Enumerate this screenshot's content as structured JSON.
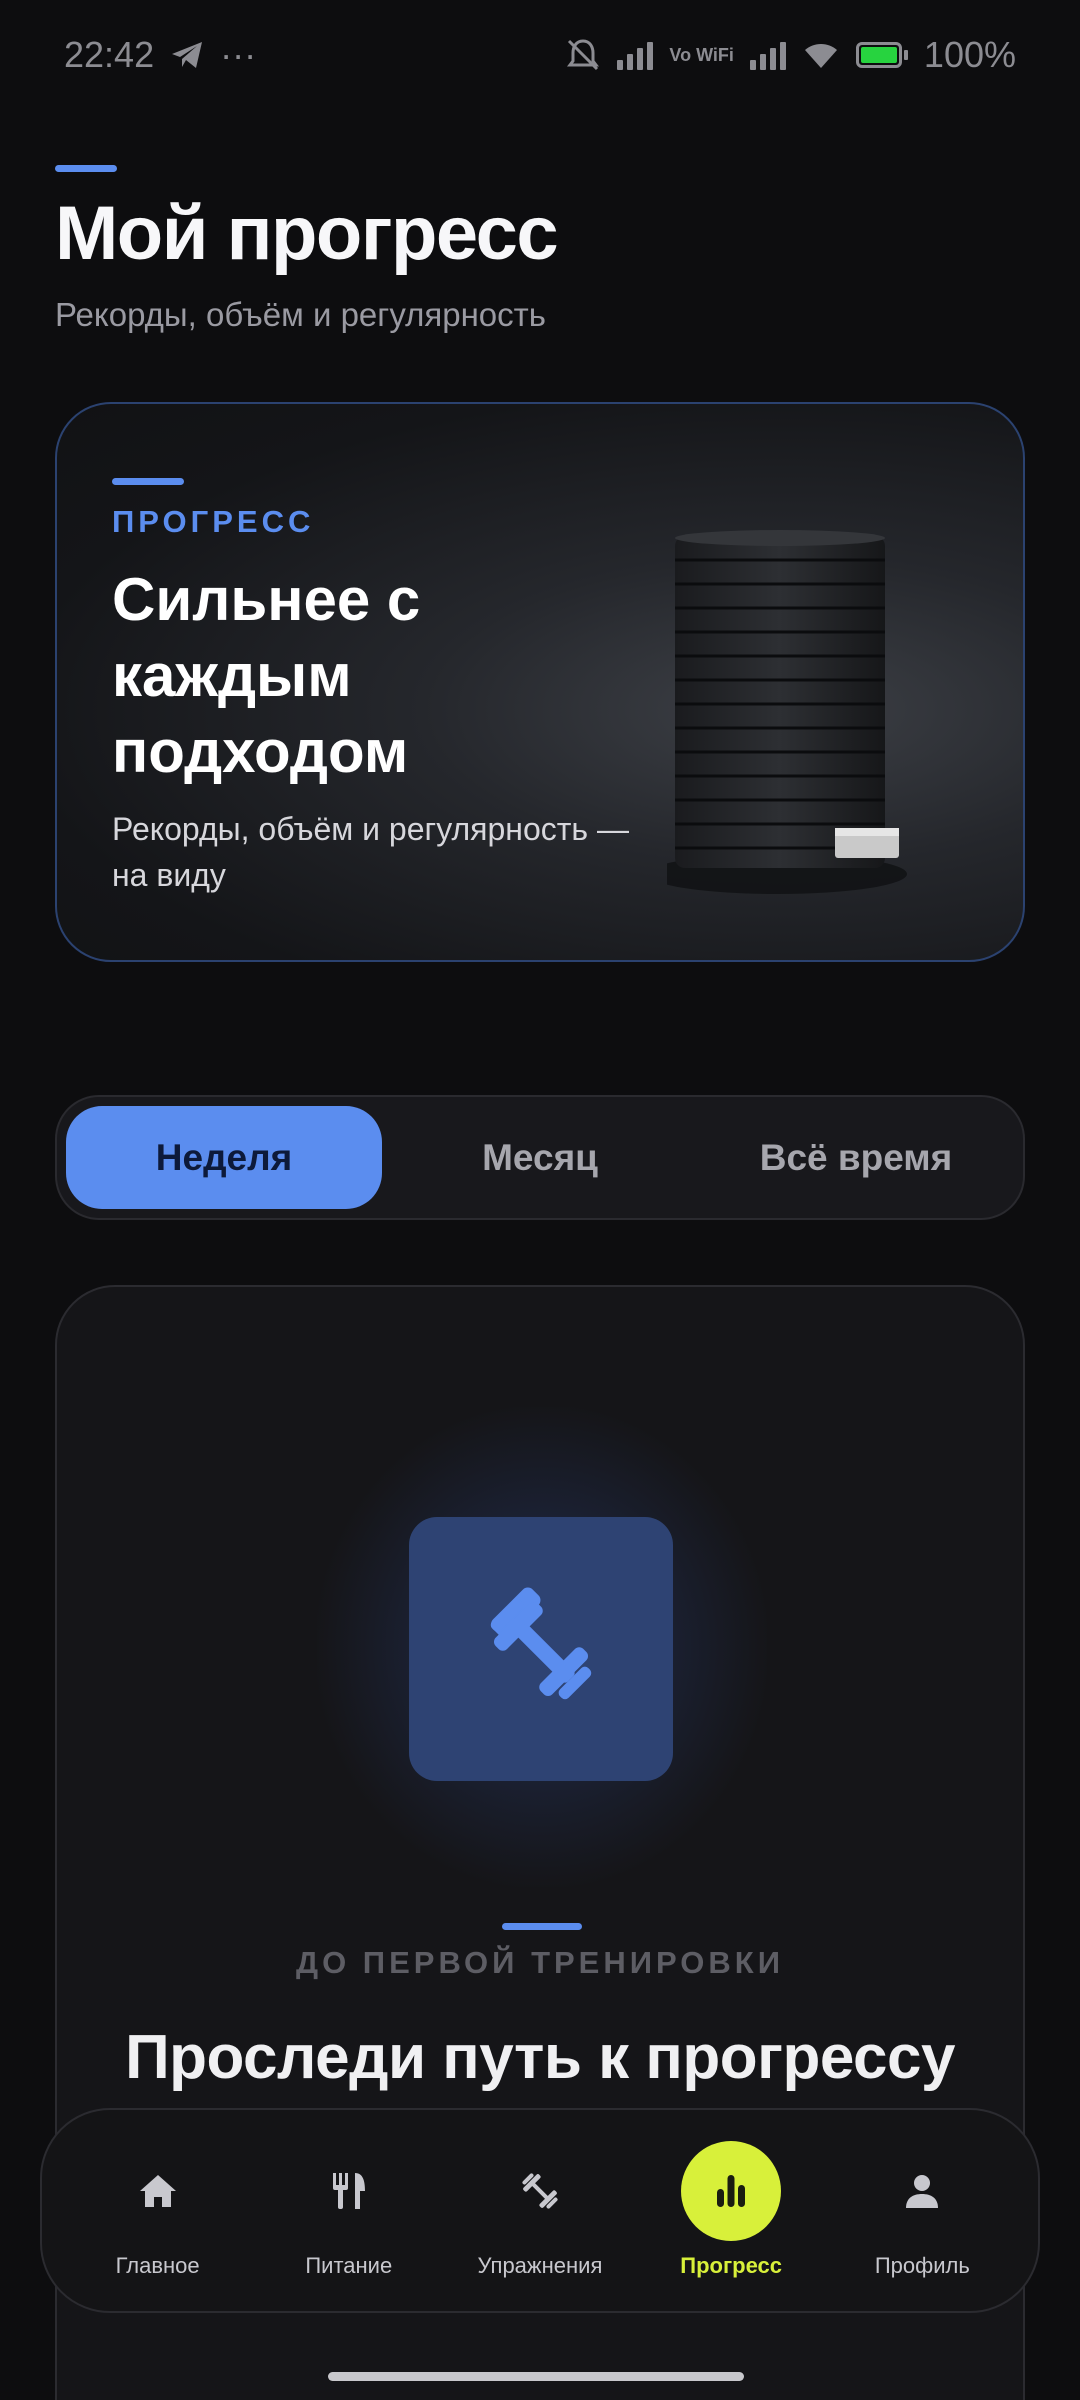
{
  "status_bar": {
    "time": "22:42",
    "dots": "···",
    "network": "Vo WiFi",
    "battery": "100%"
  },
  "header": {
    "title": "Мой прогресс",
    "subtitle": "Рекорды, объём и регулярность"
  },
  "hero": {
    "kicker": "ПРОГРЕСС",
    "title": "Сильнее с каждым подходом",
    "subtitle": "Рекорды, объём и регулярность — на виду"
  },
  "period_tabs": {
    "selected": "Неделя",
    "items": [
      {
        "label": "Неделя"
      },
      {
        "label": "Месяц"
      },
      {
        "label": "Всё время"
      }
    ]
  },
  "empty_state": {
    "kicker": "ДО ПЕРВОЙ ТРЕНИРОВКИ",
    "title": "Проследи путь к прогрессу",
    "icon": "dumbbell-icon"
  },
  "bottom_nav": {
    "active": "Прогресс",
    "items": [
      {
        "label": "Главное",
        "icon": "home-icon"
      },
      {
        "label": "Питание",
        "icon": "fork-knife-icon"
      },
      {
        "label": "Упражнения",
        "icon": "dumbbell-icon"
      },
      {
        "label": "Прогресс",
        "icon": "bar-chart-icon"
      },
      {
        "label": "Профиль",
        "icon": "person-icon"
      }
    ]
  },
  "colors": {
    "background": "#0d0d0f",
    "accent_blue": "#5b8def",
    "accent_lime": "#d8f03a",
    "card": "#151518"
  }
}
